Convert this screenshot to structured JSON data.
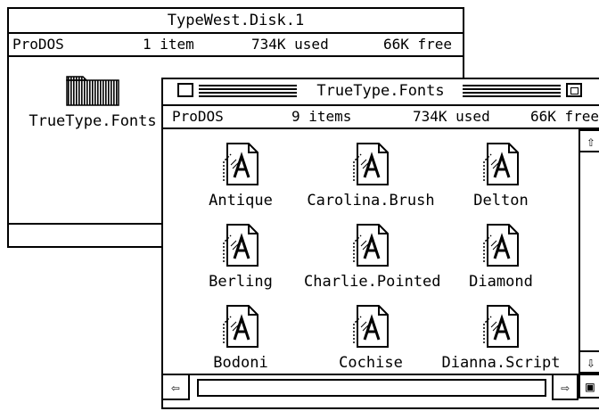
{
  "back_window": {
    "title": "TypeWest.Disk.1",
    "info": {
      "format": "ProDOS",
      "items": "1 item",
      "used": "734K used",
      "free": "66K free"
    },
    "folder": {
      "label": "TrueType.Fonts",
      "icon": "folder-icon"
    }
  },
  "front_window": {
    "title": "TrueType.Fonts",
    "info": {
      "format": "ProDOS",
      "items": "9 items",
      "used": "734K used",
      "free": "66K free"
    },
    "files": [
      {
        "label": "Antique"
      },
      {
        "label": "Carolina.Brush"
      },
      {
        "label": "Delton"
      },
      {
        "label": "Berling"
      },
      {
        "label": "Charlie.Pointed"
      },
      {
        "label": "Diamond"
      },
      {
        "label": "Bodoni"
      },
      {
        "label": "Cochise"
      },
      {
        "label": "Dianna.Script"
      }
    ],
    "icons": {
      "file": "truetype-font-file-icon",
      "close": "close-box-icon",
      "zoom": "zoom-box-icon",
      "scroll_left": "arrow-left-icon",
      "scroll_right": "arrow-right-icon",
      "scroll_up": "arrow-up-icon",
      "scroll_down": "arrow-down-icon"
    }
  }
}
